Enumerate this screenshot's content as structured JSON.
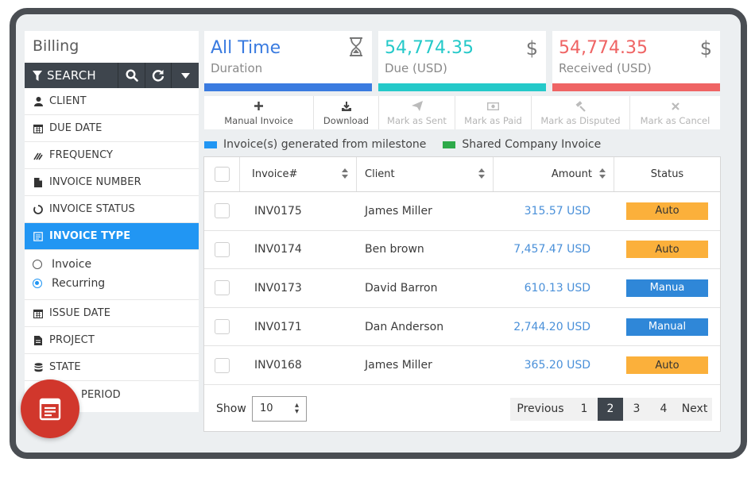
{
  "sidebar": {
    "title": "Billing",
    "search_label": "SEARCH",
    "filters_top": [
      {
        "label": "CLIENT",
        "icon": "user-icon"
      },
      {
        "label": "DUE DATE",
        "icon": "calendar-icon"
      },
      {
        "label": "FREQUENCY",
        "icon": "frequency-icon"
      },
      {
        "label": "INVOICE NUMBER",
        "icon": "document-icon"
      },
      {
        "label": "INVOICE STATUS",
        "icon": "status-ring-icon"
      }
    ],
    "active_filter": {
      "label": "INVOICE TYPE",
      "icon": "invoice-type-icon"
    },
    "type_options": [
      {
        "label": "Invoice",
        "selected": false
      },
      {
        "label": "Recurring",
        "selected": true
      }
    ],
    "filters_bottom": [
      {
        "label": "ISSUE DATE",
        "icon": "calendar-icon"
      },
      {
        "label": "PROJECT",
        "icon": "project-icon"
      },
      {
        "label": "STATE",
        "icon": "database-icon"
      },
      {
        "label": "PERIOD",
        "icon": "period-icon"
      }
    ]
  },
  "cards": [
    {
      "value": "All Time",
      "label": "Duration",
      "icon": "hourglass-icon",
      "color": "#3a7be0"
    },
    {
      "value": "54,774.35",
      "label": "Due (USD)",
      "icon": "dollar-icon",
      "color": "#24c9c9"
    },
    {
      "value": "54,774.35",
      "label": "Received (USD)",
      "icon": "dollar-icon",
      "color": "#ef6464"
    }
  ],
  "toolbar": [
    {
      "label": "Manual Invoice",
      "icon": "plus-icon",
      "enabled": true
    },
    {
      "label": "Download",
      "icon": "download-icon",
      "enabled": true
    },
    {
      "label": "Mark as Sent",
      "icon": "send-icon",
      "enabled": false
    },
    {
      "label": "Mark as Paid",
      "icon": "money-icon",
      "enabled": false
    },
    {
      "label": "Mark as Disputed",
      "icon": "gavel-icon",
      "enabled": false
    },
    {
      "label": "Mark as Cancel",
      "icon": "close-icon",
      "enabled": false
    }
  ],
  "legend": [
    {
      "label": "Invoice(s) generated from milestone",
      "color": "#2196f3"
    },
    {
      "label": "Shared Company Invoice",
      "color": "#2eaa4a"
    }
  ],
  "table": {
    "columns": [
      "Invoice#",
      "Client",
      "Amount",
      "Status"
    ],
    "rows": [
      {
        "invoice": "INV0175",
        "client": "James Miller",
        "amount": "315.57 USD",
        "status": "Auto",
        "kind": "auto"
      },
      {
        "invoice": "INV0174",
        "client": "Ben brown",
        "amount": "7,457.47 USD",
        "status": "Auto",
        "kind": "auto"
      },
      {
        "invoice": "INV0173",
        "client": "David Barron",
        "amount": "610.13 USD",
        "status": "Manua",
        "kind": "manual"
      },
      {
        "invoice": "INV0171",
        "client": "Dan Anderson",
        "amount": "2,744.20 USD",
        "status": "Manual",
        "kind": "manual"
      },
      {
        "invoice": "INV0168",
        "client": "James Miller",
        "amount": "365.20 USD",
        "status": "Auto",
        "kind": "auto"
      }
    ]
  },
  "footer": {
    "show_label": "Show",
    "page_size": "10",
    "pagination": [
      "Previous",
      "1",
      "2",
      "3",
      "4",
      "Next"
    ],
    "current_page": "2"
  }
}
